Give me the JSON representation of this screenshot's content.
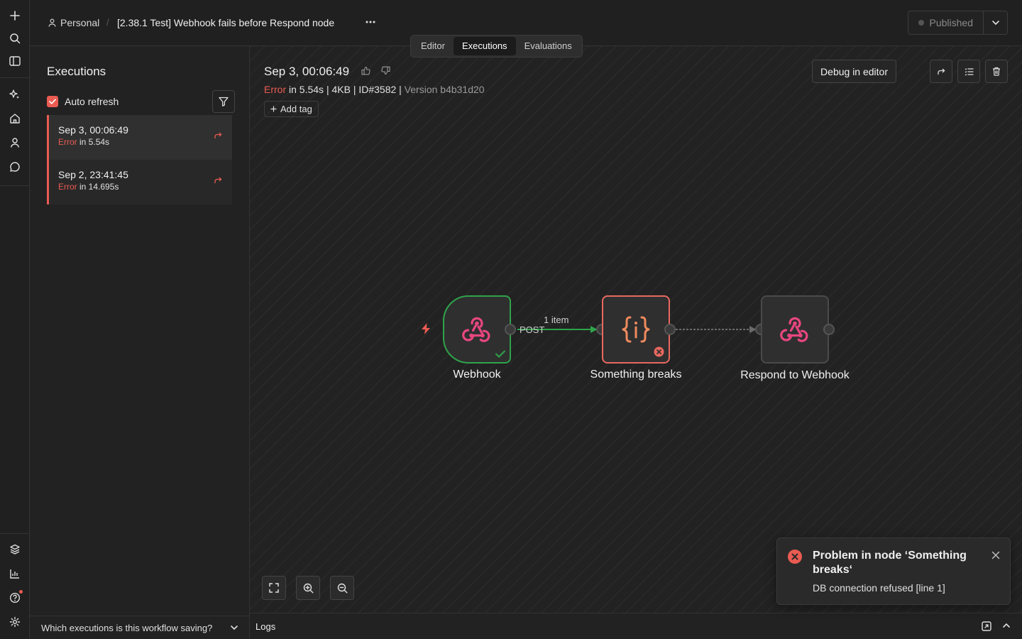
{
  "header": {
    "project": "Personal",
    "separator": "/",
    "workflow_title": "[2.38.1 Test] Webhook fails before Respond node",
    "tabs": [
      {
        "label": "Editor"
      },
      {
        "label": "Executions"
      },
      {
        "label": "Evaluations"
      }
    ],
    "active_tab": "Executions",
    "publish_label": "Published"
  },
  "sidebar": {
    "title": "Executions",
    "auto_refresh_label": "Auto refresh",
    "auto_refresh_checked": true,
    "items": [
      {
        "date": "Sep 3, 00:06:49",
        "status": "Error",
        "duration": " in 5.54s",
        "selected": true
      },
      {
        "date": "Sep 2, 23:41:45",
        "status": "Error",
        "duration": " in 14.695s",
        "selected": false
      }
    ],
    "footer_label": "Which executions is this workflow saving?"
  },
  "execution": {
    "date": "Sep 3, 00:06:49",
    "status": "Error",
    "meta": " in 5.54s | 4KB | ID#3582 | ",
    "version": "Version b4b31d20",
    "add_tag_label": "Add tag",
    "debug_label": "Debug in editor"
  },
  "nodes": [
    {
      "label": "Webhook",
      "icon": "webhook-icon",
      "state": "success"
    },
    {
      "label": "Something breaks",
      "icon": "code-braces-icon",
      "state": "error"
    },
    {
      "label": "Respond to Webhook",
      "icon": "webhook-icon",
      "state": "idle"
    }
  ],
  "connections": {
    "webhook_output_label": "POST",
    "items_label": "1 item"
  },
  "logs": {
    "label": "Logs"
  },
  "toast": {
    "title": "Problem in node ‘Something breaks‘",
    "message": "DB connection refused [line 1]"
  },
  "colors": {
    "accent_error": "#ea5b52",
    "success": "#2fa34a",
    "webhook_pink": "#e8467f",
    "code_orange": "#f08a5d"
  }
}
